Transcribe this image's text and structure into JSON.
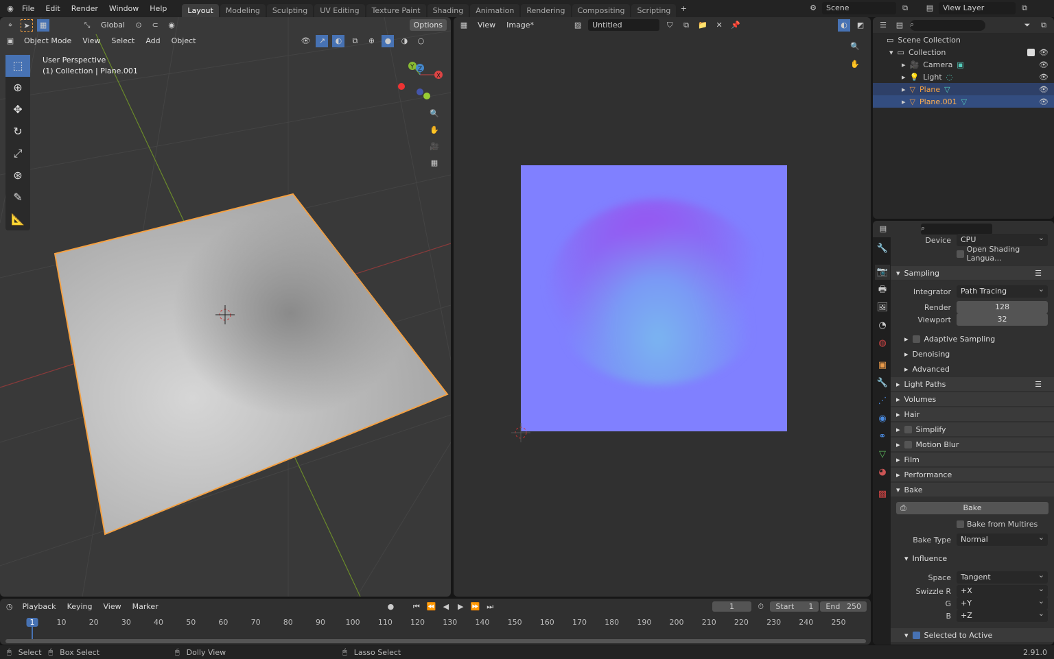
{
  "topbar": {
    "menus": [
      "File",
      "Edit",
      "Render",
      "Window",
      "Help"
    ],
    "tabs": [
      "Layout",
      "Modeling",
      "Sculpting",
      "UV Editing",
      "Texture Paint",
      "Shading",
      "Animation",
      "Rendering",
      "Compositing",
      "Scripting"
    ],
    "active_tab": "Layout",
    "scene": "Scene",
    "view_layer": "View Layer"
  },
  "viewport": {
    "transform": "Global",
    "options": "Options",
    "mode": "Object Mode",
    "menus": [
      "View",
      "Select",
      "Add",
      "Object"
    ],
    "overlay_title": "User Perspective",
    "overlay_sub": "(1) Collection | Plane.001",
    "gizmo": {
      "x": "X",
      "y": "Y",
      "z": "Z"
    },
    "tools": [
      "select-box",
      "cursor",
      "move",
      "rotate",
      "scale",
      "transform",
      "annotate",
      "measure"
    ]
  },
  "image_editor": {
    "menus": [
      "View",
      "Image*"
    ],
    "image_name": "Untitled",
    "bake_color": "#8080ff"
  },
  "outliner": {
    "root": "Scene Collection",
    "collection": "Collection",
    "items": [
      {
        "name": "Camera",
        "selected": false
      },
      {
        "name": "Light",
        "selected": false
      },
      {
        "name": "Plane",
        "selected": true
      },
      {
        "name": "Plane.001",
        "selected": true
      }
    ]
  },
  "properties": {
    "device_label": "Device",
    "device": "CPU",
    "osl": "Open Shading Langua...",
    "sampling": "Sampling",
    "integrator_label": "Integrator",
    "integrator": "Path Tracing",
    "render_label": "Render",
    "render": "128",
    "viewport_label": "Viewport",
    "viewport": "32",
    "adaptive": "Adaptive Sampling",
    "denoising": "Denoising",
    "advanced": "Advanced",
    "panels": [
      "Light Paths",
      "Volumes",
      "Hair",
      "Simplify",
      "Motion Blur",
      "Film",
      "Performance"
    ],
    "bake": "Bake",
    "bake_button": "Bake",
    "bake_multires": "Bake from Multires",
    "bake_type_label": "Bake Type",
    "bake_type": "Normal",
    "influence": "Influence",
    "space_label": "Space",
    "space": "Tangent",
    "swizzle_r_label": "Swizzle R",
    "swizzle_r": "+X",
    "g_label": "G",
    "g": "+Y",
    "b_label": "B",
    "b": "+Z",
    "selected_to_active": "Selected to Active"
  },
  "timeline": {
    "menus": [
      "Playback",
      "Keying",
      "View",
      "Marker"
    ],
    "current_frame": "1",
    "start_label": "Start",
    "start": "1",
    "end_label": "End",
    "end": "250",
    "ticks": [
      "1",
      "10",
      "20",
      "30",
      "40",
      "50",
      "60",
      "70",
      "80",
      "90",
      "100",
      "110",
      "120",
      "130",
      "140",
      "150",
      "160",
      "170",
      "180",
      "190",
      "200",
      "210",
      "220",
      "230",
      "240",
      "250"
    ]
  },
  "status": {
    "select": "Select",
    "box_select": "Box Select",
    "dolly": "Dolly View",
    "lasso": "Lasso Select",
    "version": "2.91.0"
  },
  "colors": {
    "accent": "#4772b3",
    "selection_outline": "#f5a142",
    "selected_row": "#334d80"
  }
}
